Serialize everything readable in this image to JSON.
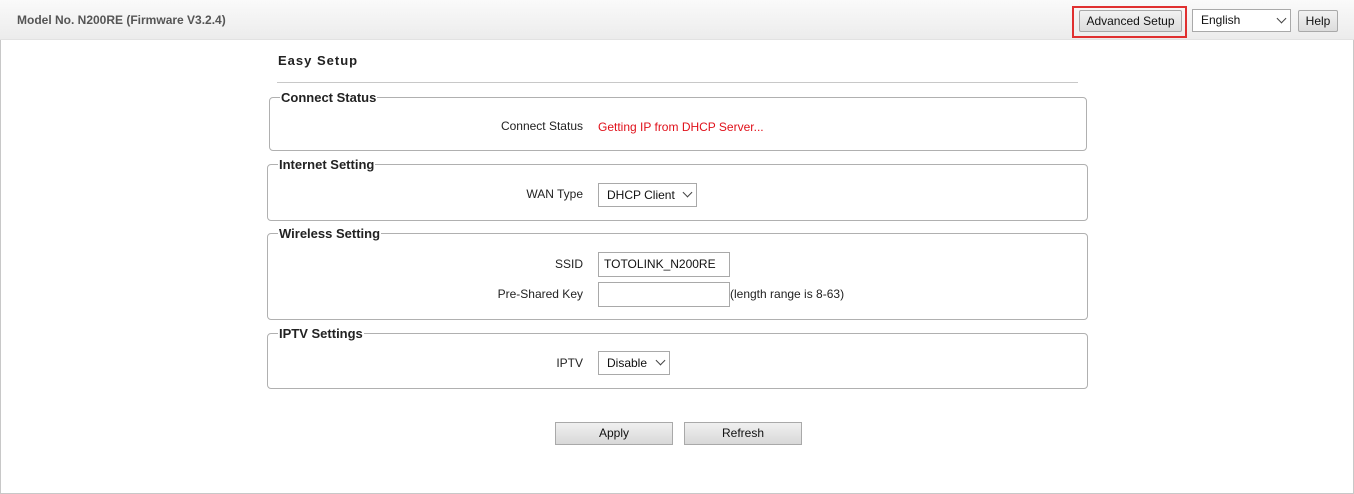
{
  "header": {
    "model": "Model No. N200RE (Firmware V3.2.4)",
    "advanced_setup_label": "Advanced Setup",
    "language": "English",
    "help_label": "Help"
  },
  "page_title": "Easy Setup",
  "connect_status": {
    "legend": "Connect Status",
    "label": "Connect Status",
    "value": "Getting IP from DHCP Server...",
    "value_color": "#e0101a"
  },
  "internet_setting": {
    "legend": "Internet Setting",
    "wan_type_label": "WAN Type",
    "wan_type_value": "DHCP Client"
  },
  "wireless_setting": {
    "legend": "Wireless Setting",
    "ssid_label": "SSID",
    "ssid_value": "TOTOLINK_N200RE",
    "psk_label": "Pre-Shared Key",
    "psk_value": "",
    "psk_hint": "(length range is 8-63)"
  },
  "iptv_settings": {
    "legend": "IPTV Settings",
    "iptv_label": "IPTV",
    "iptv_value": "Disable"
  },
  "actions": {
    "apply_label": "Apply",
    "refresh_label": "Refresh"
  }
}
